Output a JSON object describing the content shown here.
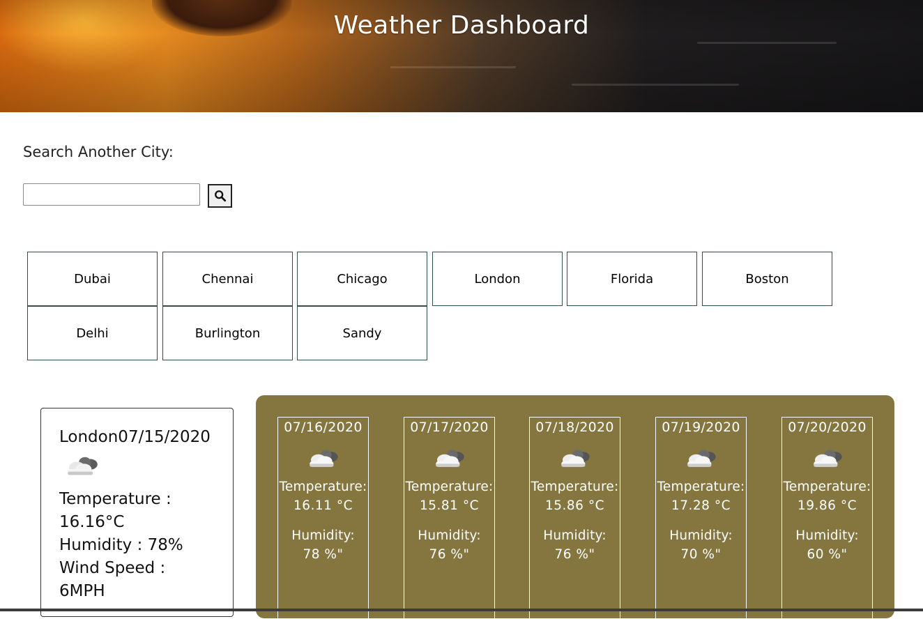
{
  "header": {
    "title": "Weather Dashboard"
  },
  "search": {
    "label": "Search Another City:",
    "value": "",
    "placeholder": "",
    "button_icon": "search-icon"
  },
  "cities": [
    "Dubai",
    "Chennai",
    "Chicago",
    "London",
    "Florida",
    "Boston",
    "Delhi",
    "Burlington",
    "Sandy"
  ],
  "current": {
    "city_date": "London07/15/2020",
    "icon": "cloud-icon",
    "temperature_label": "Temperature :",
    "temperature_value": "16.16°C",
    "humidity": "Humidity : 78%",
    "wind_label": "Wind Speed :",
    "wind_value": "6MPH"
  },
  "forecast": [
    {
      "date": "07/16/2020",
      "icon": "cloud-icon",
      "temp_label": "Temperature:",
      "temp": "16.11 °C",
      "hum_label": "Humidity:",
      "humidity": "78 %\""
    },
    {
      "date": "07/17/2020",
      "icon": "cloud-icon",
      "temp_label": "Temperature:",
      "temp": "15.81 °C",
      "hum_label": "Humidity:",
      "humidity": "76 %\""
    },
    {
      "date": "07/18/2020",
      "icon": "cloud-icon",
      "temp_label": "Temperature:",
      "temp": "15.86 °C",
      "hum_label": "Humidity:",
      "humidity": "76 %\""
    },
    {
      "date": "07/19/2020",
      "icon": "cloud-icon",
      "temp_label": "Temperature:",
      "temp": "17.28 °C",
      "hum_label": "Humidity:",
      "humidity": "70 %\""
    },
    {
      "date": "07/20/2020",
      "icon": "cloud-icon",
      "temp_label": "Temperature:",
      "temp": "19.86 °C",
      "hum_label": "Humidity:",
      "humidity": "60 %\""
    }
  ],
  "colors": {
    "forecast_panel": "#857640",
    "city_border": "#2f4f4f"
  }
}
